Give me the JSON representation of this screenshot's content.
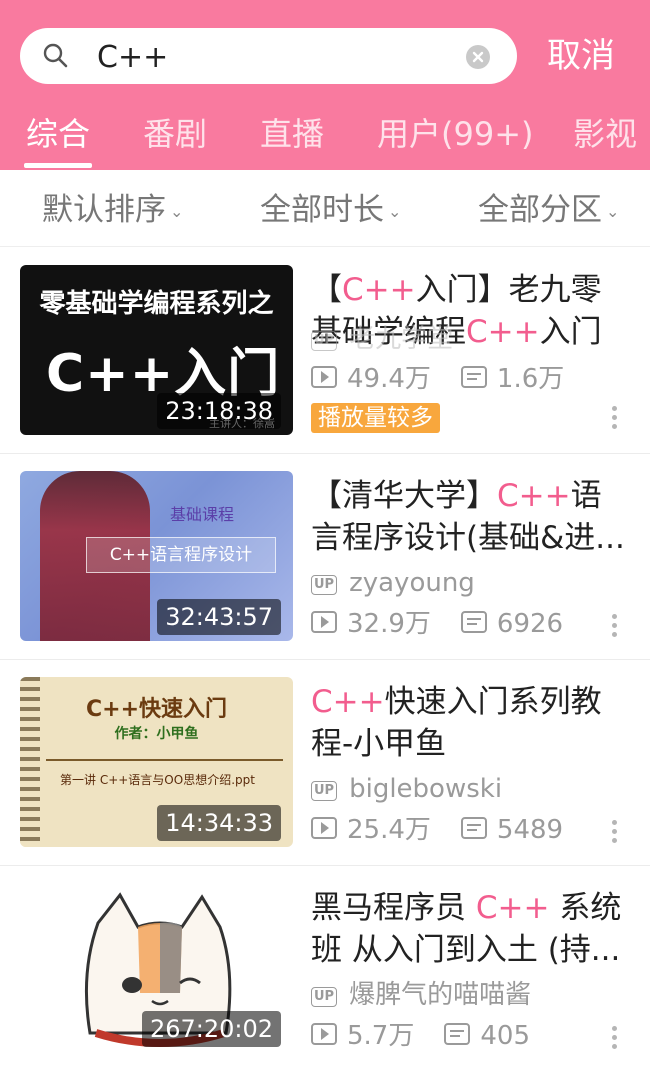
{
  "search": {
    "query": "C++",
    "cancel_label": "取消"
  },
  "tabs": [
    {
      "label": "综合"
    },
    {
      "label": "番剧"
    },
    {
      "label": "直播"
    },
    {
      "label": "用户(99+)"
    },
    {
      "label": "影视"
    }
  ],
  "filters": [
    {
      "label": "默认排序"
    },
    {
      "label": "全部时长"
    },
    {
      "label": "全部分区"
    }
  ],
  "videos": [
    {
      "title_parts": [
        "【",
        "C++",
        "入门】老九零基础学编程",
        "C++",
        "入门 ..."
      ],
      "uploader": "老九学堂",
      "duration": "23:18:38",
      "plays": "49.4万",
      "danmaku": "1.6万",
      "tag": "播放量较多",
      "thumb_text_1": "零基础学编程系列之",
      "thumb_text_2": "C++入门",
      "thumb_text_3": "主讲人：徐嵩"
    },
    {
      "title_parts": [
        "【清华大学】",
        "C++",
        "语言程序设计(基础&进..."
      ],
      "uploader": "zyayoung",
      "duration": "32:43:57",
      "plays": "32.9万",
      "danmaku": "6926",
      "thumb_text_1": "基础课程",
      "thumb_text_2": "C++语言程序设计"
    },
    {
      "title_parts": [
        "C++",
        "快速入门系列教程-小甲鱼"
      ],
      "uploader": "biglebowski",
      "duration": "14:34:33",
      "plays": "25.4万",
      "danmaku": "5489",
      "thumb_text_1": "C++快速入门",
      "thumb_text_2": "作者：小甲鱼",
      "thumb_text_3": "第一讲 C++语言与OO思想介绍.ppt"
    },
    {
      "title_parts": [
        "黑马程序员 ",
        "C++",
        " 系统班 从入门到入土 (持..."
      ],
      "uploader": "爆脾气的喵喵酱",
      "duration": "267:20:02",
      "plays": "5.7万",
      "danmaku": "405"
    }
  ],
  "colors": {
    "brand_pink": "#F97A9F",
    "keyword_pink": "#F25D8E",
    "tag_orange": "#F8A73D"
  }
}
